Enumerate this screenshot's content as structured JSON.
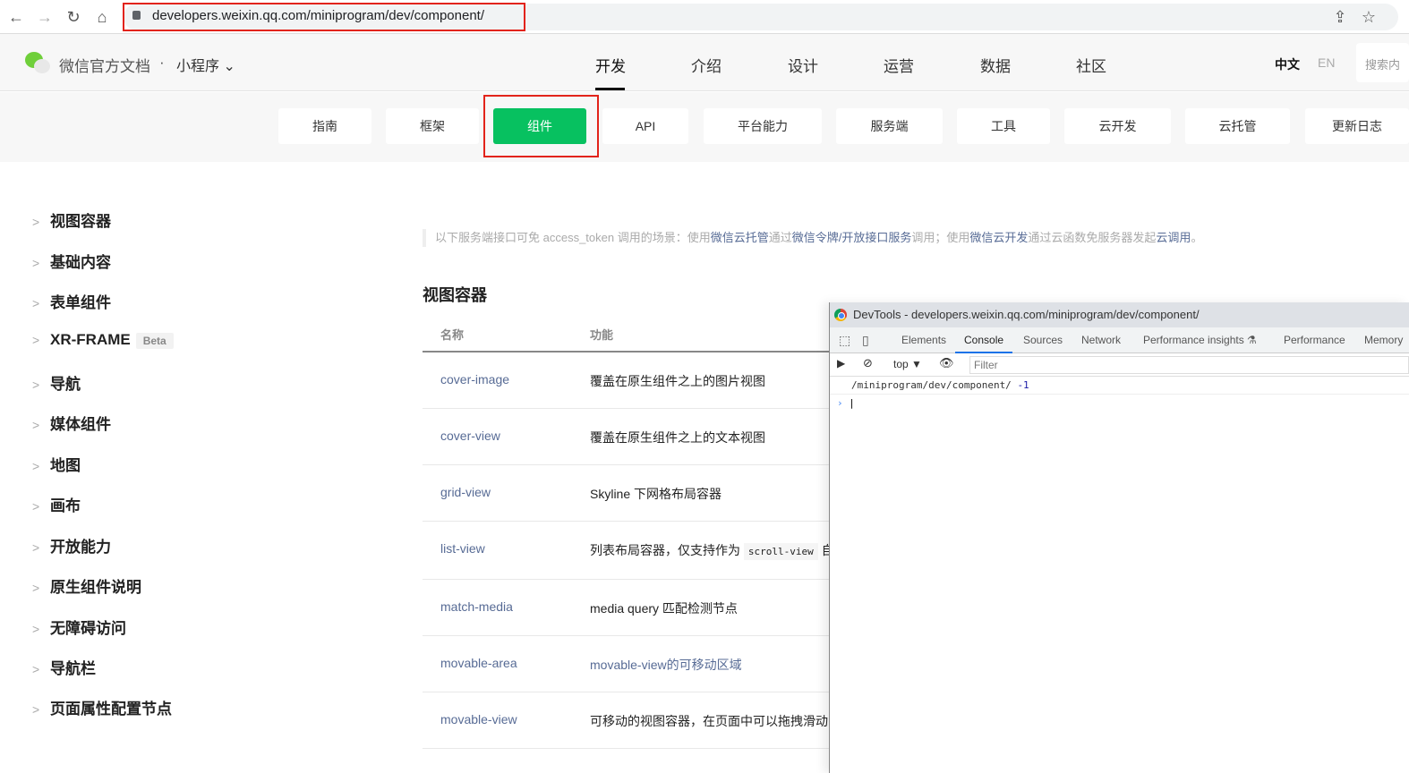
{
  "browser": {
    "url": "developers.weixin.qq.com/miniprogram/dev/component/"
  },
  "header": {
    "logo_text": "微信官方文档",
    "dot": "·",
    "product": "小程序",
    "nav": [
      "开发",
      "介绍",
      "设计",
      "运营",
      "数据",
      "社区"
    ],
    "lang_zh": "中文",
    "lang_en": "EN",
    "search_placeholder": "搜索内"
  },
  "subnav": [
    "指南",
    "框架",
    "组件",
    "API",
    "平台能力",
    "服务端",
    "工具",
    "云开发",
    "云托管",
    "更新日志"
  ],
  "sidebar": [
    "视图容器",
    "基础内容",
    "表单组件",
    "XR-FRAME",
    "导航",
    "媒体组件",
    "地图",
    "画布",
    "开放能力",
    "原生组件说明",
    "无障碍访问",
    "导航栏",
    "页面属性配置节点"
  ],
  "sidebar_badge": "Beta",
  "notice": {
    "p1": "以下服务端接口可免 access_token 调用的场景：使用",
    "l1": "微信云托管",
    "p2": "通过",
    "l2": "微信令牌/开放接口服务",
    "p3": "调用；使用",
    "l3": "微信云开发",
    "p4": "通过云函数免服务器发起",
    "l4": "云调用",
    "p5": "。"
  },
  "section_title": "视图容器",
  "table": {
    "headers": [
      "名称",
      "功能"
    ],
    "rows": [
      [
        "cover-image",
        "覆盖在原生组件之上的图片视图"
      ],
      [
        "cover-view",
        "覆盖在原生组件之上的文本视图"
      ],
      [
        "grid-view",
        "Skyline 下网格布局容器"
      ],
      [
        "list-view",
        "列表布局容器，仅支持作为",
        "scroll-view",
        "自"
      ],
      [
        "match-media",
        "media query 匹配检测节点"
      ],
      [
        "movable-area",
        "movable-view的可移动区域"
      ],
      [
        "movable-view",
        "可移动的视图容器，在页面中可以拖拽滑动"
      ]
    ]
  },
  "devtools": {
    "title": "DevTools - developers.weixin.qq.com/miniprogram/dev/component/",
    "tabs": [
      "Elements",
      "Console",
      "Sources",
      "Network",
      "Performance insights",
      "Performance",
      "Memory"
    ],
    "context": "top ▼",
    "filter": "Filter",
    "log_text": "/miniprogram/dev/component/",
    "log_value": "-1",
    "prompt": "›"
  },
  "colors": {
    "accent": "#07c160",
    "link": "#576b95",
    "highlight": "#e2231a"
  }
}
